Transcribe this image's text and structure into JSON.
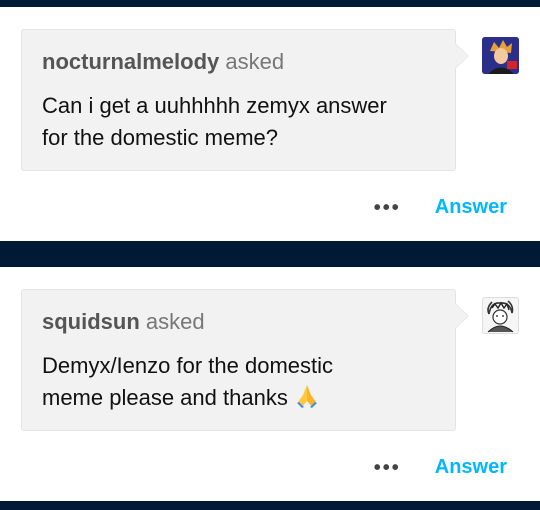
{
  "posts": [
    {
      "asker": "nocturnalmelody",
      "asked_label": "asked",
      "question_lines": [
        "Can i get a uuhhhhh zemyx answer",
        "for the domestic meme?"
      ],
      "more_icon": "ellipsis-icon",
      "answer_label": "Answer"
    },
    {
      "asker": "squidsun",
      "asked_label": "asked",
      "question_lines": [
        "Demyx/Ienzo for the domestic",
        "meme please and thanks"
      ],
      "question_emoji": "folded-hands-emoji",
      "more_icon": "ellipsis-icon",
      "answer_label": "Answer"
    }
  ],
  "colors": {
    "background": "#001935",
    "accent": "#00b8ff",
    "bubble": "#f2f2f2"
  }
}
